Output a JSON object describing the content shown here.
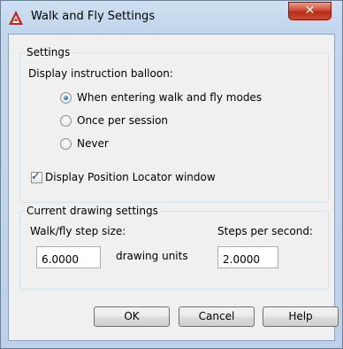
{
  "window": {
    "title": "Walk and Fly Settings",
    "close_glyph": "✕",
    "app_icon": "autocad-logo-icon"
  },
  "settings_group": {
    "legend": "Settings",
    "balloon_label": "Display instruction balloon:",
    "options": [
      {
        "label": "When entering walk and fly modes",
        "checked": true
      },
      {
        "label": "Once per session",
        "checked": false
      },
      {
        "label": "Never",
        "checked": false
      }
    ],
    "position_locator": {
      "label": "Display Position Locator window",
      "checked": true
    }
  },
  "current_group": {
    "legend": "Current drawing settings",
    "step_size_label": "Walk/fly step size:",
    "step_size_value": "6.0000",
    "step_size_units": "drawing units",
    "steps_per_second_label": "Steps per second:",
    "steps_per_second_value": "2.0000"
  },
  "buttons": {
    "ok": "OK",
    "cancel": "Cancel",
    "help": "Help"
  },
  "colors": {
    "title_bar": "#c2d6ec",
    "close_button": "#c84b34",
    "radio_dot": "#1b63c6"
  }
}
